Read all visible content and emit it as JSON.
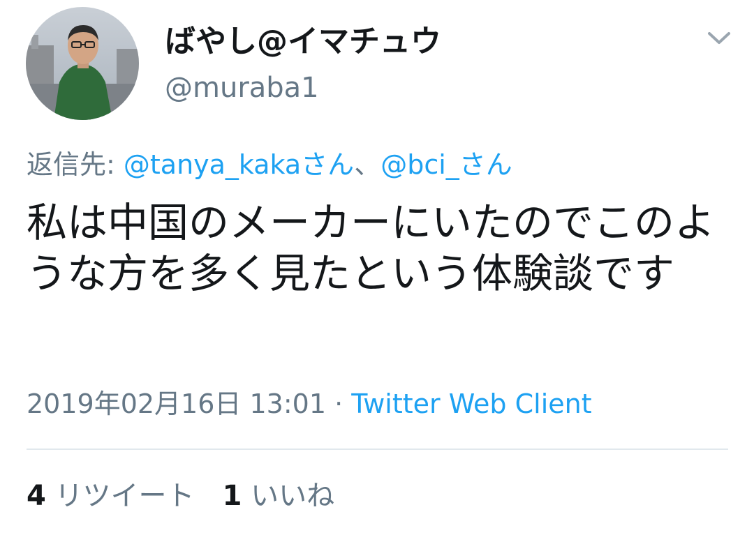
{
  "tweet": {
    "author": {
      "display_name": "ばやし@イマチュウ",
      "handle": "@muraba1"
    },
    "reply_to": {
      "prefix": "返信先: ",
      "mention_1": "@tanya_kakaさん",
      "separator": "、",
      "mention_2": "@bci_さん"
    },
    "text": "私は中国のメーカーにいたのでこのような方を多く見たという体験談です",
    "timestamp": "2019年02月16日 13:01",
    "dot": " · ",
    "client": "Twitter Web Client",
    "stats": {
      "retweets_count": "4",
      "retweets_label": "リツイート",
      "likes_count": "1",
      "likes_label": "いいね"
    }
  },
  "icons": {
    "menu": "chevron-down-icon",
    "avatar": "avatar"
  },
  "colors": {
    "text": "#14171a",
    "secondary": "#657786",
    "link": "#1da1f2",
    "divider": "#e1e8ed"
  }
}
